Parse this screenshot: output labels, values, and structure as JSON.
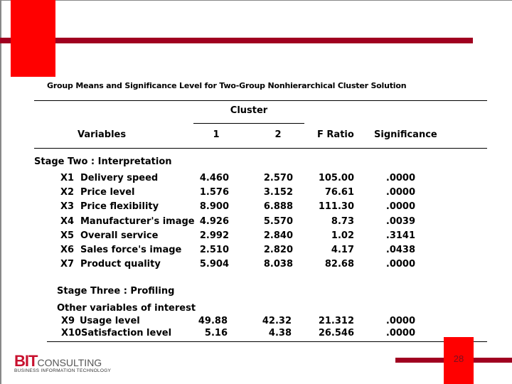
{
  "slide": {
    "title": "Group Means and Significance Level for Two-Group Nonhierarchical Cluster Solution",
    "page_number": "28",
    "colors": {
      "accent_red": "#ff0000",
      "bar_dark_red": "#a00020"
    }
  },
  "table": {
    "header": {
      "cluster_label": "Cluster",
      "variables": "Variables",
      "cluster_1": "1",
      "cluster_2": "2",
      "f_ratio": "F Ratio",
      "significance": "Significance"
    },
    "stage_two": {
      "label": "Stage Two : Interpretation",
      "rows": [
        {
          "code": "X1",
          "name": "Delivery speed",
          "c1": "4.460",
          "c2": "2.570",
          "f": "105.00",
          "sig": ".0000"
        },
        {
          "code": "X2",
          "name": "Price level",
          "c1": "1.576",
          "c2": "3.152",
          "f": "76.61",
          "sig": ".0000"
        },
        {
          "code": "X3",
          "name": "Price flexibility",
          "c1": "8.900",
          "c2": "6.888",
          "f": "111.30",
          "sig": ".0000"
        },
        {
          "code": "X4",
          "name": "Manufacturer's image",
          "c1": "4.926",
          "c2": "5.570",
          "f": "8.73",
          "sig": ".0039"
        },
        {
          "code": "X5",
          "name": "Overall service",
          "c1": "2.992",
          "c2": "2.840",
          "f": "1.02",
          "sig": ".3141"
        },
        {
          "code": "X6",
          "name": "Sales force's image",
          "c1": "2.510",
          "c2": "2.820",
          "f": "4.17",
          "sig": ".0438"
        },
        {
          "code": "X7",
          "name": "Product quality",
          "c1": "5.904",
          "c2": "8.038",
          "f": "82.68",
          "sig": ".0000"
        }
      ]
    },
    "stage_three": {
      "label": "Stage Three : Profiling",
      "sublabel": "Other variables of interest",
      "rows": [
        {
          "code": "X9",
          "name": "Usage level",
          "c1": "49.88",
          "c2": "42.32",
          "f": "21.312",
          "sig": ".0000"
        },
        {
          "code": "X10",
          "name": "Satisfaction level",
          "c1": "5.16",
          "c2": "4.38",
          "f": "26.546",
          "sig": ".0000"
        }
      ]
    }
  },
  "logo": {
    "bit": "BIT",
    "consulting": "CONSULTING",
    "tagline": "BUSINESS INFORMATION TECHNOLOGY"
  }
}
